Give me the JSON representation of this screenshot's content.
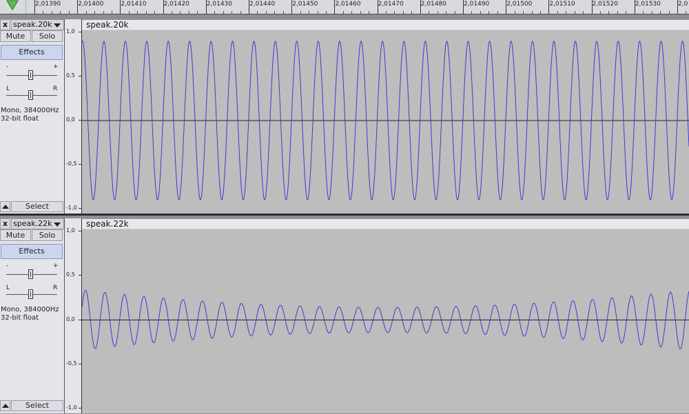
{
  "ruler": {
    "labels": [
      "2,01390",
      "2,01400",
      "2,01410",
      "2,01420",
      "2,01430",
      "2,01440",
      "2,01450",
      "2,01460",
      "2,01470",
      "2,01480",
      "2,01490",
      "2,01500",
      "2,01510",
      "2,01520",
      "2,01530",
      "2,0"
    ],
    "icon": "play-head-triangle-icon",
    "accent_color": "#4caf50"
  },
  "tracks": [
    {
      "name": "speak.20k",
      "close": "x",
      "mute": "Mute",
      "solo": "Solo",
      "effects": "Effects",
      "gain_minus": "-",
      "gain_plus": "+",
      "pan_left": "L",
      "pan_right": "R",
      "rate": "Mono, 384000Hz",
      "format": "32-bit float",
      "select": "Select",
      "scale": [
        "1,0",
        "0,5",
        "0,0",
        "-0,5",
        "-1,0"
      ],
      "clip_title": "speak.20k",
      "wave_color": "#3b3bd0",
      "amplitude": 0.9,
      "amplitude_mod": 0.0
    },
    {
      "name": "speak.22k",
      "close": "x",
      "mute": "Mute",
      "solo": "Solo",
      "effects": "Effects",
      "gain_minus": "-",
      "gain_plus": "+",
      "pan_left": "L",
      "pan_right": "R",
      "rate": "Mono, 384000Hz",
      "format": "32-bit float",
      "select": "Select",
      "scale": [
        "1,0",
        "0,5",
        "0,0",
        "-0,5",
        "-1,0"
      ],
      "clip_title": "speak.22k",
      "wave_color": "#3b3bd0",
      "amplitude": 0.34,
      "amplitude_mod": 0.2
    }
  ]
}
